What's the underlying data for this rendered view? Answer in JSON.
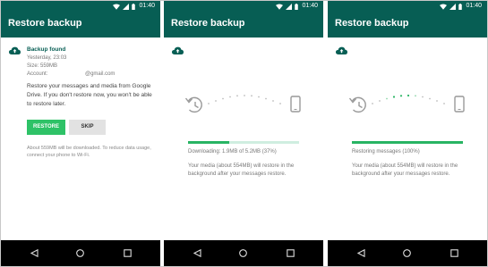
{
  "status_bar": {
    "time": "01:40"
  },
  "screens": [
    {
      "app_title": "Restore backup",
      "backup": {
        "title": "Backup found",
        "date": "Yesterday, 23:03",
        "size": "Size: 559MB",
        "account_label": "Account:",
        "account_value": "@gmail.com"
      },
      "description": "Restore your messages and media from Google Drive. If you don't restore now, you won't be able to restore later.",
      "restore_button": "RESTORE",
      "skip_button": "SKIP",
      "note": "About 559MB will be downloaded. To reduce data usage, connect your phone to Wi-Fi."
    },
    {
      "app_title": "Restore backup",
      "progress_text": "Downloading: 1.9MB of 5.2MB (37%)",
      "progress": 0.37,
      "media_note": "Your media (about 554MB) will restore in the background after your messages restore."
    },
    {
      "app_title": "Restore backup",
      "progress_text": "Restoring messages (100%)",
      "progress": 1.0,
      "media_note": "Your media (about 554MB) will restore in the background after your messages restore."
    }
  ],
  "colors": {
    "primary_dark": "#075e54",
    "accent_green": "#2ec267",
    "progress_track": "#cfeee0",
    "progress_fill": "#28b463"
  },
  "icons": [
    "wifi-icon",
    "signal-icon",
    "battery-icon",
    "cloud-icon",
    "restore-history-icon",
    "phone-icon",
    "nav-back-icon",
    "nav-home-icon",
    "nav-recent-icon"
  ]
}
